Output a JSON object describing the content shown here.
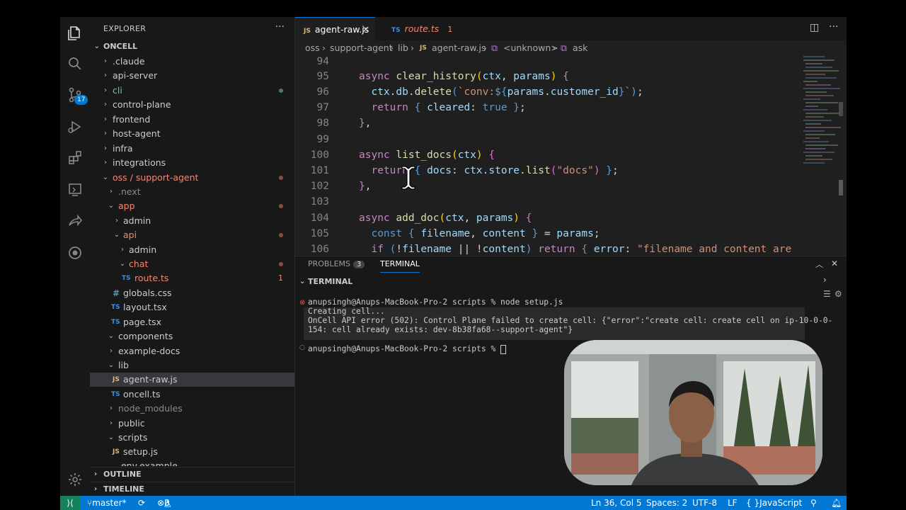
{
  "explorer": {
    "title": "EXPLORER",
    "root": "ONCELL",
    "tree": [
      {
        "label": ".claude"
      },
      {
        "label": "api-server"
      },
      {
        "label": "cli"
      },
      {
        "label": "control-plane"
      },
      {
        "label": "frontend"
      },
      {
        "label": "host-agent"
      },
      {
        "label": "infra"
      },
      {
        "label": "integrations"
      },
      {
        "label": "oss / support-agent"
      },
      {
        "label": ".next"
      },
      {
        "label": "app"
      },
      {
        "label": "admin"
      },
      {
        "label": "api"
      },
      {
        "label": "admin"
      },
      {
        "label": "chat"
      },
      {
        "label": "route.ts",
        "count": "1"
      },
      {
        "label": "globals.css"
      },
      {
        "label": "layout.tsx"
      },
      {
        "label": "page.tsx"
      },
      {
        "label": "components"
      },
      {
        "label": "example-docs"
      },
      {
        "label": "lib"
      },
      {
        "label": "agent-raw.js"
      },
      {
        "label": "oncell.ts"
      },
      {
        "label": "node_modules"
      },
      {
        "label": "public"
      },
      {
        "label": "scripts"
      },
      {
        "label": "setup.js"
      },
      {
        "label": ".env.example"
      }
    ],
    "outline": "OUTLINE",
    "timeline": "TIMELINE"
  },
  "activity": {
    "scm_badge": "17"
  },
  "tabs": [
    {
      "label": "agent-raw.js",
      "icon": "JS"
    },
    {
      "label": "route.ts",
      "icon": "TS",
      "problems": "1"
    }
  ],
  "breadcrumb": [
    "oss",
    "support-agent",
    "lib",
    "agent-raw.js",
    "<unknown>",
    "ask"
  ],
  "code": {
    "line_numbers": [
      "94",
      "95",
      "96",
      "97",
      "98",
      "99",
      "100",
      "101",
      "102",
      "103",
      "104",
      "105",
      "106"
    ]
  },
  "panel": {
    "problems_label": "PROBLEMS",
    "problems_count": "3",
    "terminal_label": "TERMINAL",
    "terminal_header": "TERMINAL",
    "lines": [
      "anupsingh@Anups-MacBook-Pro-2 scripts % node setup.js",
      "Creating cell...",
      "OnCell API error (502): Control Plane failed to create cell: {\"error\":\"create cell: create cell on ip-10-0-0-",
      "154: cell already exists: dev-8b38fa68--support-agent\"}",
      "anupsingh@Anups-MacBook-Pro-2 scripts % "
    ]
  },
  "status": {
    "branch": "master*",
    "errors": "3",
    "warnings": "0",
    "position": "Ln 36, Col 5",
    "spaces": "Spaces: 2",
    "encoding": "UTF-8",
    "eol": "LF",
    "language": "JavaScript"
  },
  "colors": {
    "accent": "#0078d4",
    "error": "#f48771",
    "modified": "#73c991"
  }
}
